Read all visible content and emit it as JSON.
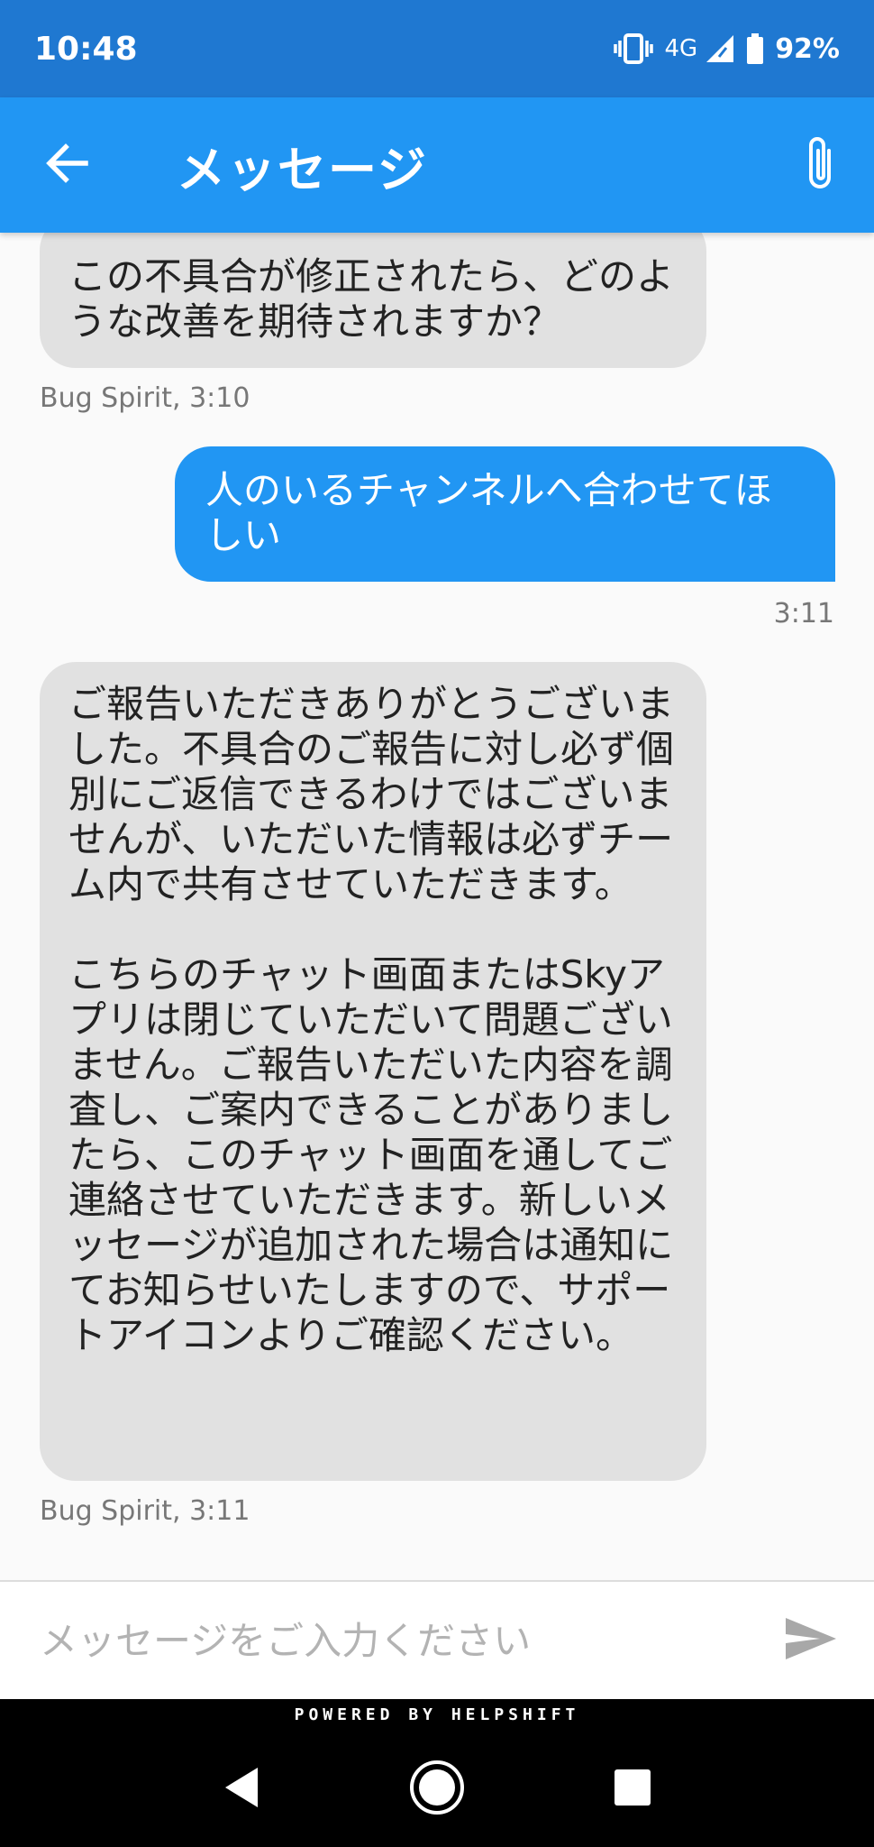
{
  "status_bar": {
    "time": "10:48",
    "network": "4G",
    "battery": "92%"
  },
  "app_bar": {
    "title": "メッセージ",
    "back_icon": "arrow-left-icon",
    "attach_icon": "paperclip-icon"
  },
  "messages": [
    {
      "direction": "incoming",
      "text": "この不具合が修正されたら、どのような改善を期待されますか？",
      "meta": "Bug Spirit, 3:10"
    },
    {
      "direction": "outgoing",
      "text": "人のいるチャンネルへ合わせてほしい",
      "meta": "3:11"
    },
    {
      "direction": "incoming",
      "text": "ご報告いただきありがとうございました。不具合のご報告に対し必ず個別にご返信できるわけではございませんが、いただいた情報は必ずチーム内で共有させていただきます。\n\nこちらのチャット画面またはSkyアプリは閉じていただいて問題ございません。ご報告いただいた内容を調査し、ご案内できることがありましたら、このチャット画面を通してご連絡させていただきます。新しいメッセージが追加された場合は通知にてお知らせいたしますので、サポートアイコンよりご確認ください。",
      "meta": "Bug Spirit, 3:11"
    }
  ],
  "composer": {
    "placeholder": "メッセージをご入力ください",
    "value": "",
    "send_icon": "send-icon"
  },
  "footer": {
    "powered_by": "POWERED BY HELPSHIFT"
  },
  "colors": {
    "status_bar": "#1f78d1",
    "app_bar": "#2196f3",
    "outgoing_bubble": "#2196f3",
    "incoming_bubble": "#e1e1e1"
  }
}
